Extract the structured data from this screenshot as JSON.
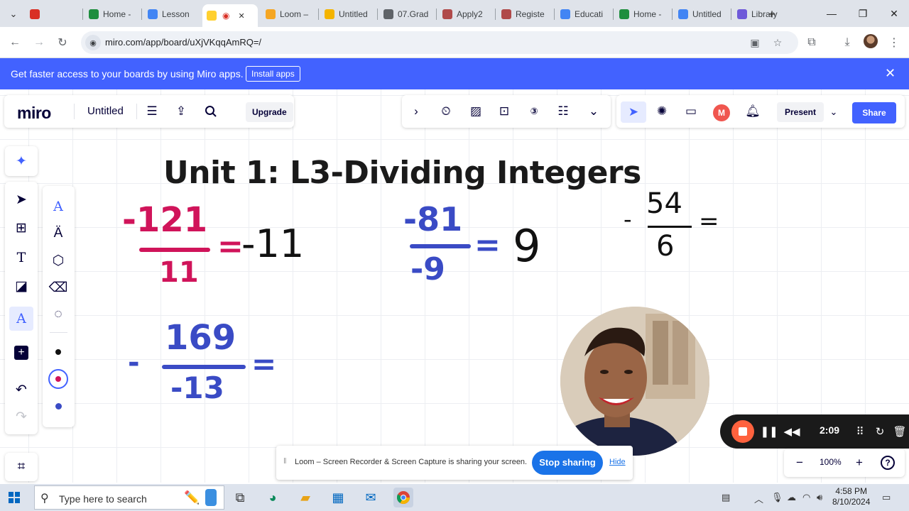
{
  "browser": {
    "tabs": [
      {
        "label": "",
        "favicon_color": "#d93025"
      },
      {
        "label": "Home -",
        "favicon_color": "#1e8e3e"
      },
      {
        "label": "Lesson",
        "favicon_color": "#4285f4"
      },
      {
        "label": "",
        "favicon_color": "#ffd02f",
        "active": true
      },
      {
        "label": "Loom –",
        "favicon_color": "#f5a623"
      },
      {
        "label": "Untitled",
        "favicon_color": "#f4b400"
      },
      {
        "label": "07.Grad",
        "favicon_color": "#5f6368"
      },
      {
        "label": "Apply2",
        "favicon_color": "#b04a4a"
      },
      {
        "label": "Registe",
        "favicon_color": "#b04a4a"
      },
      {
        "label": "Educati",
        "favicon_color": "#4285f4"
      },
      {
        "label": "Home -",
        "favicon_color": "#1e8e3e"
      },
      {
        "label": "Untitled",
        "favicon_color": "#4285f4"
      },
      {
        "label": "Library",
        "favicon_color": "#6e59d9"
      }
    ],
    "url": "miro.com/app/board/uXjVKqqAmRQ=/"
  },
  "banner": {
    "text": "Get faster access to your boards by using Miro apps.",
    "button": "Install apps"
  },
  "miro": {
    "logo": "miro",
    "board_title": "Untitled",
    "upgrade": "Upgrade",
    "present": "Present",
    "share": "Share",
    "avatar_initial": "M",
    "zoom": "100%"
  },
  "board": {
    "heading": "Unit 1: L3-Dividing Integers",
    "problems": [
      {
        "id": "p1",
        "numerator": "-121",
        "denominator": "11",
        "result": "-11",
        "color": "#d0145a"
      },
      {
        "id": "p2",
        "numerator": "-81",
        "denominator": "-9",
        "result": "9",
        "color": "#3a4bc5"
      },
      {
        "id": "p3",
        "numerator": "54",
        "denominator": "6",
        "sign": "-",
        "color": "#111111"
      },
      {
        "id": "p4",
        "numerator": "169",
        "denominator": "-13",
        "sign": "-",
        "color": "#3a4bc5"
      }
    ]
  },
  "loom": {
    "timer": "2:09",
    "notice": "Loom – Screen Recorder & Screen Capture is sharing your screen.",
    "stop_sharing": "Stop sharing",
    "hide": "Hide"
  },
  "taskbar": {
    "search_placeholder": "Type here to search",
    "time": "4:58 PM",
    "date": "8/10/2024"
  }
}
